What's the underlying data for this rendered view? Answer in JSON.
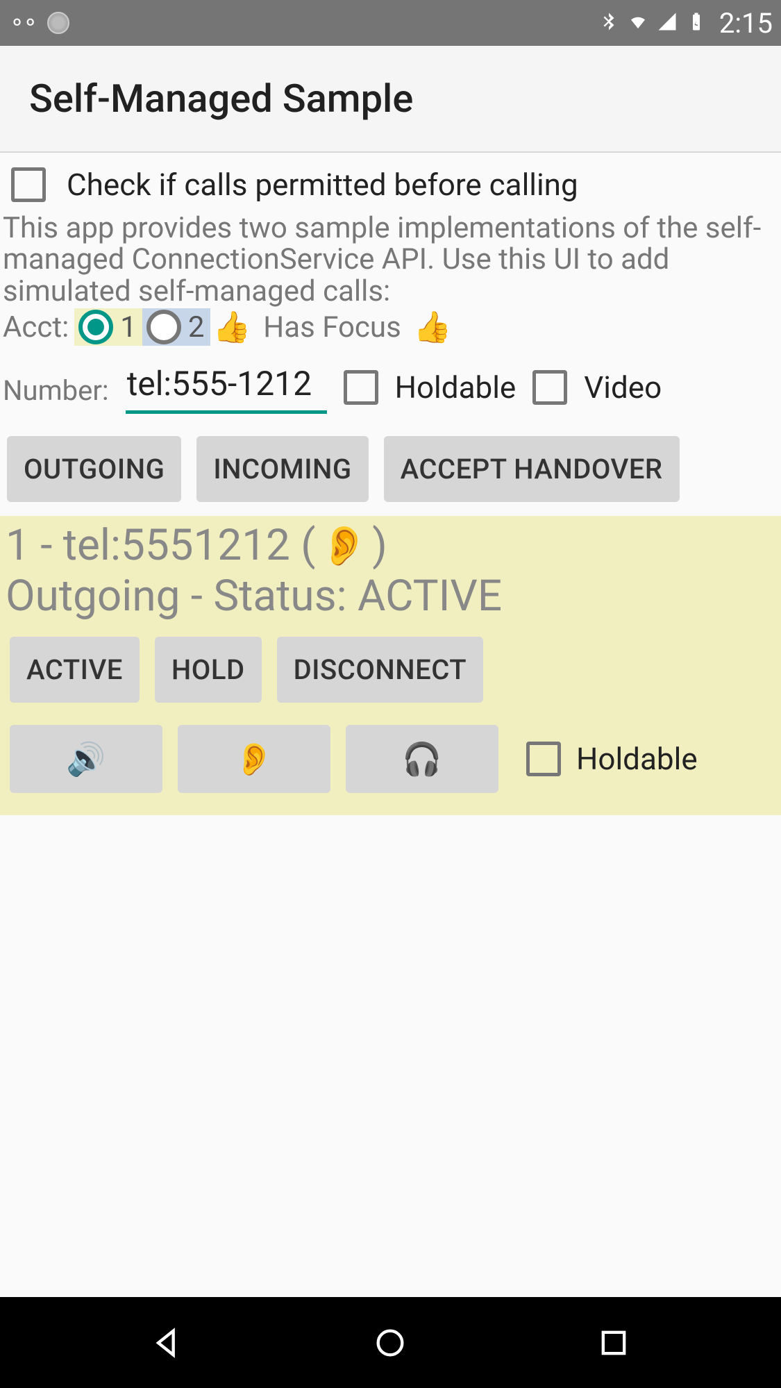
{
  "status": {
    "clock": "2:15"
  },
  "app": {
    "title": "Self-Managed Sample"
  },
  "permit_check": {
    "label": "Check if calls permitted before calling"
  },
  "description": "This app provides two sample implementations of the self-managed ConnectionService API.  Use this UI to add simulated self-managed calls:",
  "acct": {
    "label": "Acct:",
    "opt1": "1",
    "opt2": "2",
    "thumb": "👍",
    "focus_label": "Has Focus",
    "thumb2": "👍"
  },
  "number": {
    "label": "Number:",
    "value": "tel:555-1212",
    "holdable_label": "Holdable",
    "video_label": "Video"
  },
  "buttons": {
    "outgoing": "OUTGOING",
    "incoming": "INCOMING",
    "accept_handover": "ACCEPT HANDOVER"
  },
  "call": {
    "line1_prefix": "1 - tel:5551212 (",
    "ear": "👂",
    "line1_suffix": ")",
    "line2": "Outgoing - Status: ACTIVE",
    "btn_active": "ACTIVE",
    "btn_hold": "HOLD",
    "btn_disconnect": "DISCONNECT",
    "icon_speaker": "🔊",
    "icon_ear": "👂",
    "icon_headphones": "🎧",
    "holdable_label": "Holdable"
  }
}
